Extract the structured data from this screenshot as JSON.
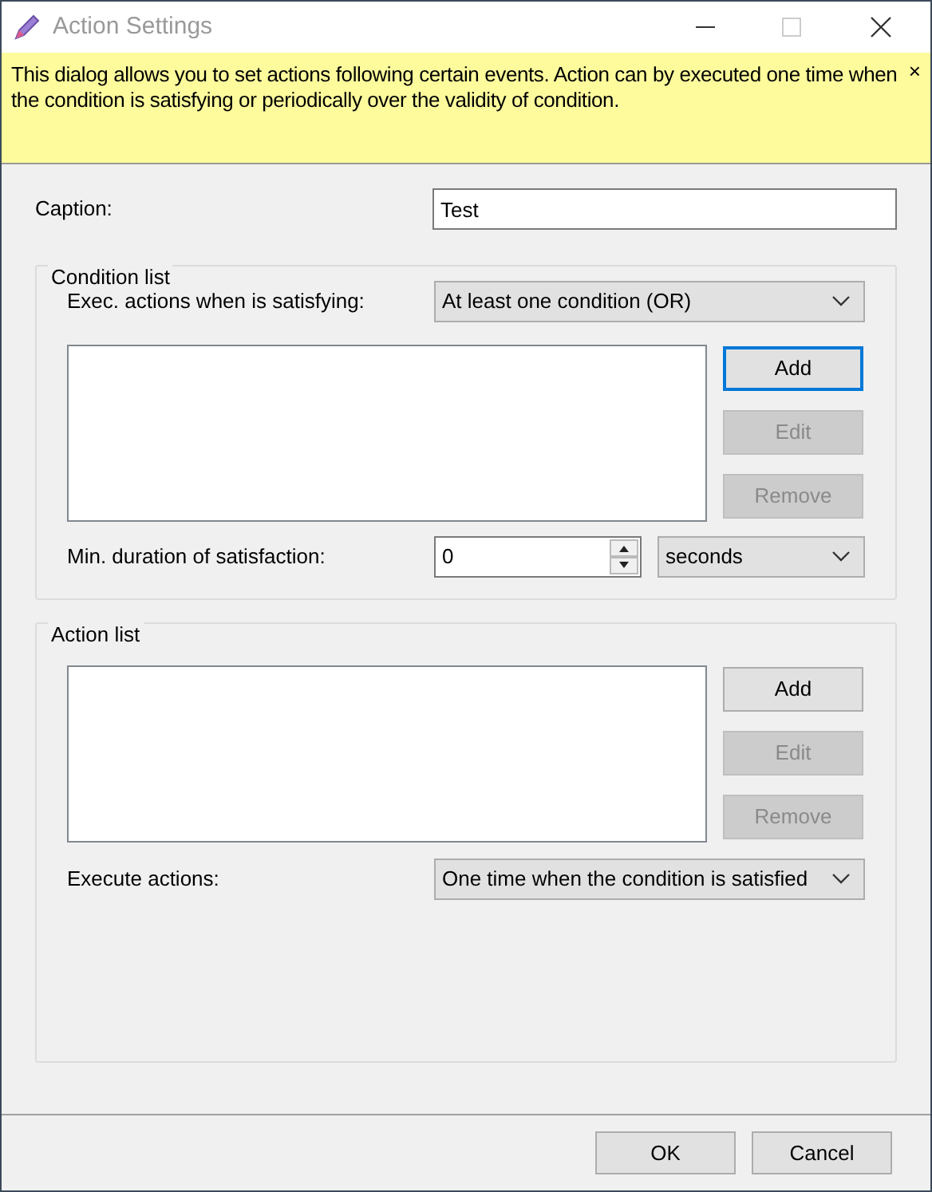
{
  "window": {
    "title": "Action Settings"
  },
  "banner": {
    "text": "This dialog allows you to set actions following certain events. Action can by executed one time when the condition is satisfying or periodically over the validity of condition.",
    "close": "×"
  },
  "caption": {
    "label": "Caption:",
    "value": "Test"
  },
  "condition_list": {
    "title": "Condition list",
    "mode_label": "Exec. actions when is satisfying:",
    "mode_value": "At least one condition (OR)",
    "buttons": [
      {
        "label": "Add",
        "disabled": false,
        "focused": true
      },
      {
        "label": "Edit",
        "disabled": true,
        "focused": false
      },
      {
        "label": "Remove",
        "disabled": true,
        "focused": false
      }
    ],
    "duration_label": "Min. duration of satisfaction:",
    "duration_value": "0",
    "unit_value": "seconds"
  },
  "action_list": {
    "title": "Action list",
    "buttons": [
      {
        "label": "Add",
        "disabled": false,
        "focused": false
      },
      {
        "label": "Edit",
        "disabled": true,
        "focused": false
      },
      {
        "label": "Remove",
        "disabled": true,
        "focused": false
      }
    ],
    "execute_label": "Execute actions:",
    "execute_value": "One time when the condition is satisfied"
  },
  "footer_buttons": [
    {
      "label": "OK"
    },
    {
      "label": "Cancel"
    }
  ]
}
